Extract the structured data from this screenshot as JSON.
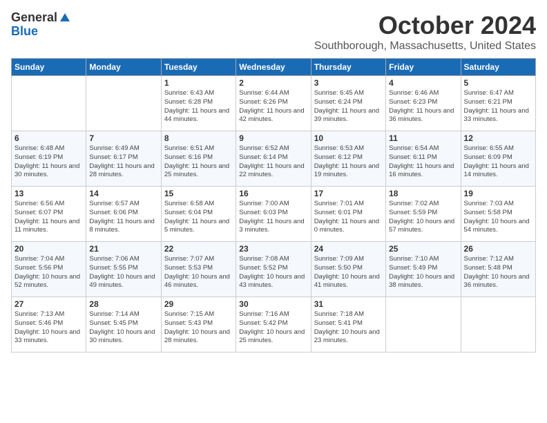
{
  "logo": {
    "general": "General",
    "blue": "Blue"
  },
  "title": "October 2024",
  "location": "Southborough, Massachusetts, United States",
  "days_of_week": [
    "Sunday",
    "Monday",
    "Tuesday",
    "Wednesday",
    "Thursday",
    "Friday",
    "Saturday"
  ],
  "weeks": [
    [
      {
        "num": "",
        "info": ""
      },
      {
        "num": "",
        "info": ""
      },
      {
        "num": "1",
        "info": "Sunrise: 6:43 AM\nSunset: 6:28 PM\nDaylight: 11 hours and 44 minutes."
      },
      {
        "num": "2",
        "info": "Sunrise: 6:44 AM\nSunset: 6:26 PM\nDaylight: 11 hours and 42 minutes."
      },
      {
        "num": "3",
        "info": "Sunrise: 6:45 AM\nSunset: 6:24 PM\nDaylight: 11 hours and 39 minutes."
      },
      {
        "num": "4",
        "info": "Sunrise: 6:46 AM\nSunset: 6:23 PM\nDaylight: 11 hours and 36 minutes."
      },
      {
        "num": "5",
        "info": "Sunrise: 6:47 AM\nSunset: 6:21 PM\nDaylight: 11 hours and 33 minutes."
      }
    ],
    [
      {
        "num": "6",
        "info": "Sunrise: 6:48 AM\nSunset: 6:19 PM\nDaylight: 11 hours and 30 minutes."
      },
      {
        "num": "7",
        "info": "Sunrise: 6:49 AM\nSunset: 6:17 PM\nDaylight: 11 hours and 28 minutes."
      },
      {
        "num": "8",
        "info": "Sunrise: 6:51 AM\nSunset: 6:16 PM\nDaylight: 11 hours and 25 minutes."
      },
      {
        "num": "9",
        "info": "Sunrise: 6:52 AM\nSunset: 6:14 PM\nDaylight: 11 hours and 22 minutes."
      },
      {
        "num": "10",
        "info": "Sunrise: 6:53 AM\nSunset: 6:12 PM\nDaylight: 11 hours and 19 minutes."
      },
      {
        "num": "11",
        "info": "Sunrise: 6:54 AM\nSunset: 6:11 PM\nDaylight: 11 hours and 16 minutes."
      },
      {
        "num": "12",
        "info": "Sunrise: 6:55 AM\nSunset: 6:09 PM\nDaylight: 11 hours and 14 minutes."
      }
    ],
    [
      {
        "num": "13",
        "info": "Sunrise: 6:56 AM\nSunset: 6:07 PM\nDaylight: 11 hours and 11 minutes."
      },
      {
        "num": "14",
        "info": "Sunrise: 6:57 AM\nSunset: 6:06 PM\nDaylight: 11 hours and 8 minutes."
      },
      {
        "num": "15",
        "info": "Sunrise: 6:58 AM\nSunset: 6:04 PM\nDaylight: 11 hours and 5 minutes."
      },
      {
        "num": "16",
        "info": "Sunrise: 7:00 AM\nSunset: 6:03 PM\nDaylight: 11 hours and 3 minutes."
      },
      {
        "num": "17",
        "info": "Sunrise: 7:01 AM\nSunset: 6:01 PM\nDaylight: 11 hours and 0 minutes."
      },
      {
        "num": "18",
        "info": "Sunrise: 7:02 AM\nSunset: 5:59 PM\nDaylight: 10 hours and 57 minutes."
      },
      {
        "num": "19",
        "info": "Sunrise: 7:03 AM\nSunset: 5:58 PM\nDaylight: 10 hours and 54 minutes."
      }
    ],
    [
      {
        "num": "20",
        "info": "Sunrise: 7:04 AM\nSunset: 5:56 PM\nDaylight: 10 hours and 52 minutes."
      },
      {
        "num": "21",
        "info": "Sunrise: 7:06 AM\nSunset: 5:55 PM\nDaylight: 10 hours and 49 minutes."
      },
      {
        "num": "22",
        "info": "Sunrise: 7:07 AM\nSunset: 5:53 PM\nDaylight: 10 hours and 46 minutes."
      },
      {
        "num": "23",
        "info": "Sunrise: 7:08 AM\nSunset: 5:52 PM\nDaylight: 10 hours and 43 minutes."
      },
      {
        "num": "24",
        "info": "Sunrise: 7:09 AM\nSunset: 5:50 PM\nDaylight: 10 hours and 41 minutes."
      },
      {
        "num": "25",
        "info": "Sunrise: 7:10 AM\nSunset: 5:49 PM\nDaylight: 10 hours and 38 minutes."
      },
      {
        "num": "26",
        "info": "Sunrise: 7:12 AM\nSunset: 5:48 PM\nDaylight: 10 hours and 36 minutes."
      }
    ],
    [
      {
        "num": "27",
        "info": "Sunrise: 7:13 AM\nSunset: 5:46 PM\nDaylight: 10 hours and 33 minutes."
      },
      {
        "num": "28",
        "info": "Sunrise: 7:14 AM\nSunset: 5:45 PM\nDaylight: 10 hours and 30 minutes."
      },
      {
        "num": "29",
        "info": "Sunrise: 7:15 AM\nSunset: 5:43 PM\nDaylight: 10 hours and 28 minutes."
      },
      {
        "num": "30",
        "info": "Sunrise: 7:16 AM\nSunset: 5:42 PM\nDaylight: 10 hours and 25 minutes."
      },
      {
        "num": "31",
        "info": "Sunrise: 7:18 AM\nSunset: 5:41 PM\nDaylight: 10 hours and 23 minutes."
      },
      {
        "num": "",
        "info": ""
      },
      {
        "num": "",
        "info": ""
      }
    ]
  ]
}
